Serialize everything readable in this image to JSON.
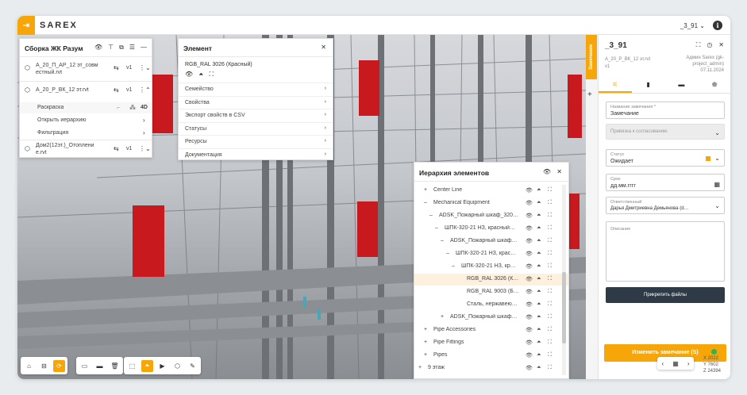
{
  "app": {
    "brand": "SAREX",
    "user": "_3_91"
  },
  "assembly": {
    "title": "Сборка ЖК Разум",
    "models": [
      {
        "name_line1": "А_20_П_АР_12 эт_совм",
        "name_line2": "естный.rvt",
        "version": "v1"
      },
      {
        "name_line1": "А_20_Р_ВК_12 эт.rvt",
        "version": "v1"
      },
      {
        "name_line1": "Дом2(12эт.)_Отоплени",
        "name_line2": "е.rvt",
        "version": "v1"
      }
    ],
    "sub": {
      "paint": "Раскраска",
      "mode": "4D",
      "open_hierarchy": "Открыть иерархию",
      "filter": "Фильтрация"
    }
  },
  "element": {
    "title": "Элемент",
    "name": "RGB_RAL 3026 (Красный)",
    "sections": [
      "Семейство",
      "Свойства",
      "Экспорт свойств в CSV",
      "Статусы",
      "Ресурсы",
      "Документация"
    ]
  },
  "hierarchy": {
    "title": "Иерархия элементов",
    "items": [
      {
        "label": "Center Line",
        "sign": "+",
        "indent": 0
      },
      {
        "label": "Mechanical Equipment",
        "sign": "–",
        "indent": 0
      },
      {
        "label": "ADSK_Пожарный шкаф_320…",
        "sign": "–",
        "indent": 1
      },
      {
        "label": "ШПК-320-21 НЗ, красный…",
        "sign": "–",
        "indent": 2
      },
      {
        "label": "ADSK_Пожарный шкаф…",
        "sign": "–",
        "indent": 3
      },
      {
        "label": "ШПК-320-21 НЗ, крас…",
        "sign": "–",
        "indent": 4
      },
      {
        "label": "ШПК-320-21 НЗ, кр…",
        "sign": "–",
        "indent": 5
      },
      {
        "label": "RGB_RAL 3026 (К…",
        "sign": "",
        "indent": 6,
        "selected": true
      },
      {
        "label": "RGB_RAL 9003 (Б…",
        "sign": "",
        "indent": 6
      },
      {
        "label": "Сталь, нержавею…",
        "sign": "",
        "indent": 6
      },
      {
        "label": "ADSK_Пожарный шкаф…",
        "sign": "+",
        "indent": 3
      },
      {
        "label": "Pipe Accessories",
        "sign": "+",
        "indent": 0
      },
      {
        "label": "Pipe Fittings",
        "sign": "+",
        "indent": 0
      },
      {
        "label": "Pipes",
        "sign": "+",
        "indent": 0
      },
      {
        "label": "9 этаж",
        "sign": "+",
        "indent": -1
      }
    ]
  },
  "remark": {
    "tab": "Замечание",
    "title": "_3_91",
    "model": "А_20_Р_ВК_12 эт.rvt",
    "version": "v1",
    "author": "Админ Sarex (gk-project_admin)",
    "date": "07.11.2024",
    "name_label": "Название замечания *",
    "name_value": "Замечание",
    "binding_placeholder": "Привязка к согласованию",
    "status_label": "Статус",
    "status_value": "Ожидает",
    "date_label": "Срок",
    "date_placeholder": "дд.мм.гггг",
    "resp_label": "Ответственный",
    "resp_value": "Дарья Дмитриевна Демьянова (d…",
    "desc_label": "Описание",
    "attach": "Прикрепить файлы",
    "save": "Изменить замечание (S)",
    "accent": "#f6a609"
  },
  "coords": {
    "x": "X 2022",
    "y": "Y 7602",
    "z": "Z 24394"
  }
}
